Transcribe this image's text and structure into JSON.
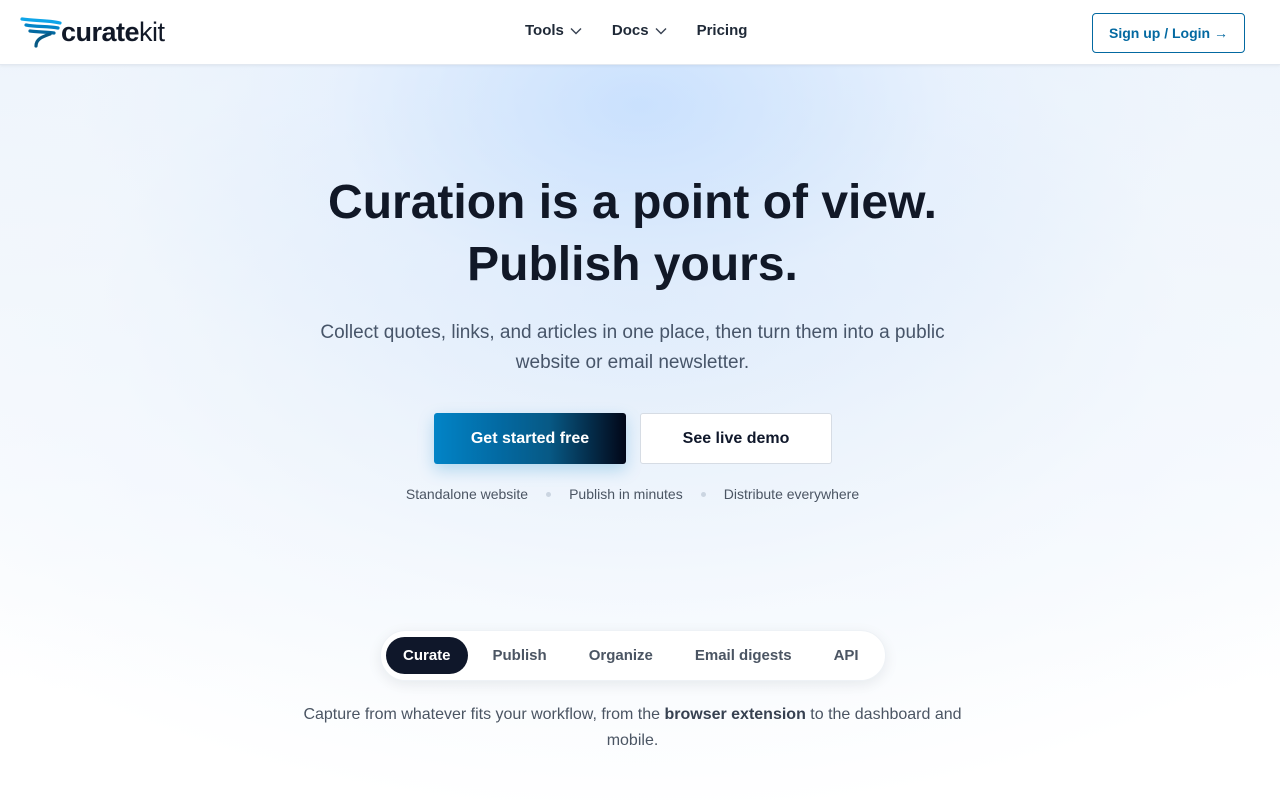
{
  "brand": {
    "logo_bold": "curate",
    "logo_light": "kit",
    "accent": "#0284c7"
  },
  "nav": {
    "items": [
      {
        "label": "Tools",
        "has_dropdown": true
      },
      {
        "label": "Docs",
        "has_dropdown": true
      },
      {
        "label": "Pricing",
        "has_dropdown": false
      }
    ],
    "signup_label": "Sign up / Login →"
  },
  "hero": {
    "title_line1": "Curation is a point of view.",
    "title_line2": "Publish yours.",
    "subtitle": "Collect quotes, links, and articles in one place, then turn them into a public website or email newsletter.",
    "primary_cta": "Get started free",
    "secondary_cta": "See live demo",
    "features": [
      "Standalone website",
      "Publish in minutes",
      "Distribute everywhere"
    ]
  },
  "tabs": {
    "items": [
      "Curate",
      "Publish",
      "Organize",
      "Email digests",
      "API"
    ],
    "active": "Curate",
    "description_before": "Capture from whatever fits your workflow, from the ",
    "description_bold": "browser extension",
    "description_after": " to the dashboard and mobile."
  }
}
